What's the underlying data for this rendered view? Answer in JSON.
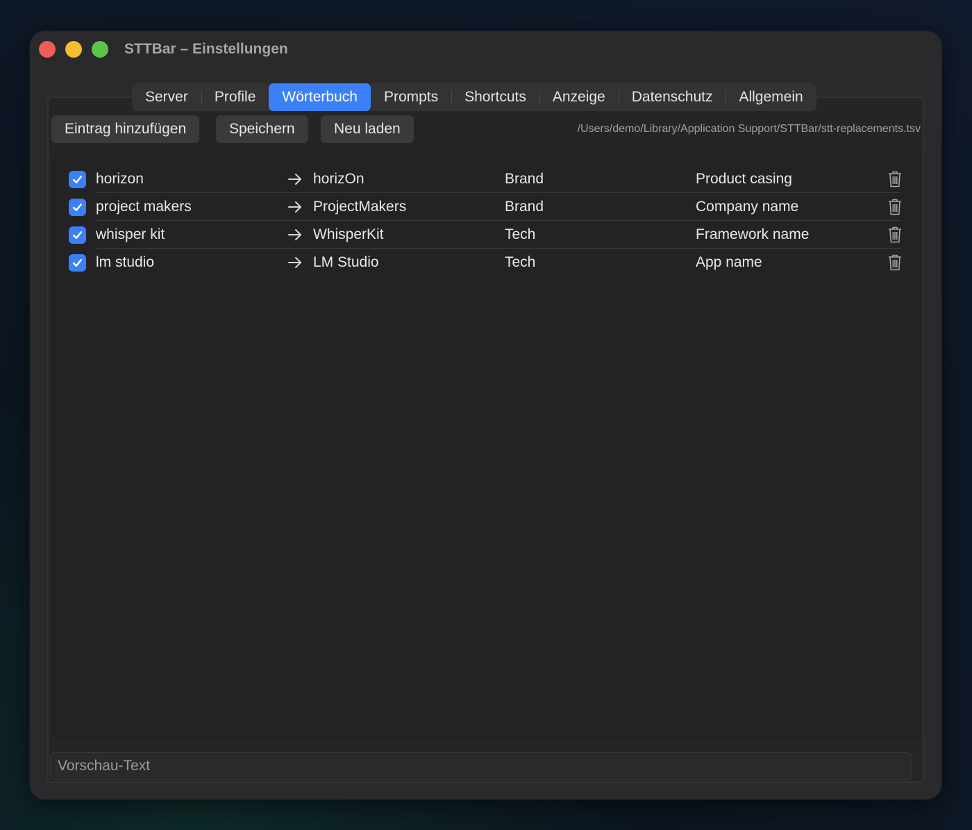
{
  "window": {
    "title": "STTBar – Einstellungen"
  },
  "tabs": [
    {
      "label": "Server",
      "active": false
    },
    {
      "label": "Profile",
      "active": false
    },
    {
      "label": "Wörterbuch",
      "active": true
    },
    {
      "label": "Prompts",
      "active": false
    },
    {
      "label": "Shortcuts",
      "active": false
    },
    {
      "label": "Anzeige",
      "active": false
    },
    {
      "label": "Datenschutz",
      "active": false
    },
    {
      "label": "Allgemein",
      "active": false
    }
  ],
  "toolbar": {
    "add_label": "Eintrag hinzufügen",
    "save_label": "Speichern",
    "reload_label": "Neu laden",
    "file_path": "/Users/demo/Library/Application Support/STTBar/stt-replacements.tsv"
  },
  "entries": [
    {
      "enabled": true,
      "from": "horizon",
      "to": "horizOn",
      "category": "Brand",
      "note": "Product casing"
    },
    {
      "enabled": true,
      "from": "project makers",
      "to": "ProjectMakers",
      "category": "Brand",
      "note": "Company name"
    },
    {
      "enabled": true,
      "from": "whisper kit",
      "to": "WhisperKit",
      "category": "Tech",
      "note": "Framework name"
    },
    {
      "enabled": true,
      "from": "lm studio",
      "to": "LM Studio",
      "category": "Tech",
      "note": "App name"
    }
  ],
  "preview": {
    "placeholder": "Vorschau-Text",
    "value": ""
  },
  "colors": {
    "accent": "#3b80f6",
    "window_bg": "#2a292c",
    "close": "#ed5e57",
    "minimize": "#f4be2e",
    "maximize": "#5cc446"
  },
  "icons": {
    "arrow": "arrow-right-icon",
    "delete": "trash-icon",
    "check": "checkmark-icon"
  }
}
